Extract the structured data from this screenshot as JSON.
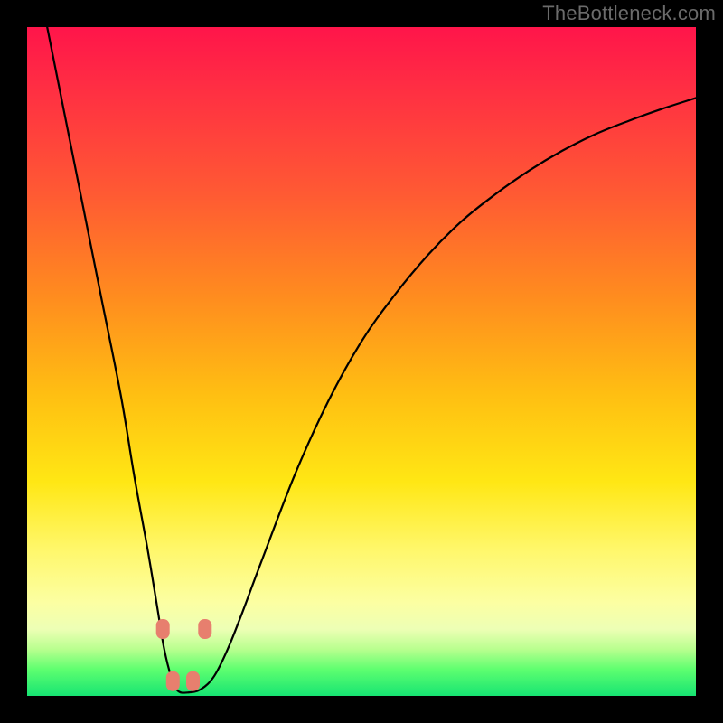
{
  "watermark": "TheBottleneck.com",
  "colors": {
    "marker": "#e77f6e",
    "curve": "#000000"
  },
  "chart_data": {
    "type": "line",
    "title": "",
    "xlabel": "",
    "ylabel": "",
    "xlim": [
      0,
      100
    ],
    "ylim": [
      0,
      100
    ],
    "grid": false,
    "legend": false,
    "series": [
      {
        "name": "bottleneck-curve",
        "x": [
          3,
          5,
          8,
          11,
          14,
          16,
          18,
          19.5,
          20.5,
          21.5,
          22.5,
          24,
          26,
          28,
          30,
          32,
          35,
          40,
          45,
          50,
          55,
          60,
          65,
          70,
          75,
          80,
          85,
          90,
          95,
          100
        ],
        "y": [
          100,
          90,
          75,
          60,
          45,
          33,
          22,
          13,
          7,
          3,
          0.8,
          0.5,
          1,
          3,
          7,
          12,
          20,
          33,
          44,
          53,
          60,
          66,
          71,
          75,
          78.5,
          81.5,
          84,
          86,
          87.8,
          89.4
        ]
      }
    ],
    "markers": [
      {
        "name": "left-upper",
        "x": 20.3,
        "y": 10.0
      },
      {
        "name": "left-lower",
        "x": 21.8,
        "y": 2.2
      },
      {
        "name": "right-lower",
        "x": 24.8,
        "y": 2.2
      },
      {
        "name": "right-upper",
        "x": 26.6,
        "y": 10.0
      }
    ]
  }
}
